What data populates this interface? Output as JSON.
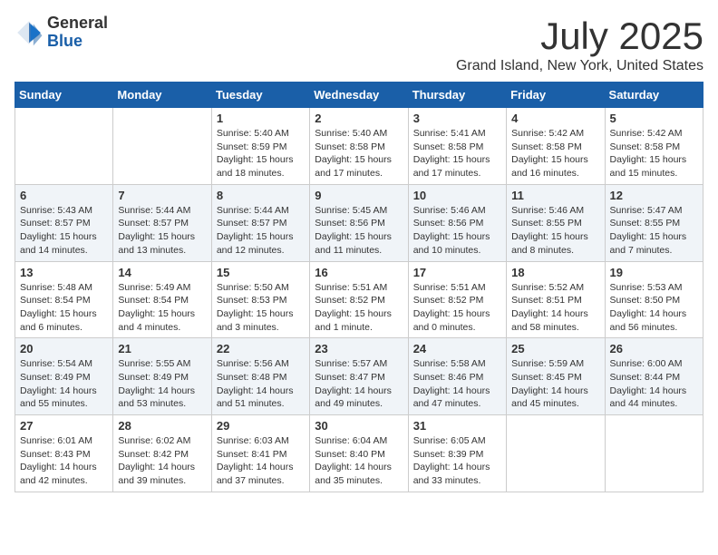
{
  "header": {
    "logo_general": "General",
    "logo_blue": "Blue",
    "month_title": "July 2025",
    "location": "Grand Island, New York, United States"
  },
  "weekdays": [
    "Sunday",
    "Monday",
    "Tuesday",
    "Wednesday",
    "Thursday",
    "Friday",
    "Saturday"
  ],
  "weeks": [
    [
      {
        "day": "",
        "sunrise": "",
        "sunset": "",
        "daylight": ""
      },
      {
        "day": "",
        "sunrise": "",
        "sunset": "",
        "daylight": ""
      },
      {
        "day": "1",
        "sunrise": "Sunrise: 5:40 AM",
        "sunset": "Sunset: 8:59 PM",
        "daylight": "Daylight: 15 hours and 18 minutes."
      },
      {
        "day": "2",
        "sunrise": "Sunrise: 5:40 AM",
        "sunset": "Sunset: 8:58 PM",
        "daylight": "Daylight: 15 hours and 17 minutes."
      },
      {
        "day": "3",
        "sunrise": "Sunrise: 5:41 AM",
        "sunset": "Sunset: 8:58 PM",
        "daylight": "Daylight: 15 hours and 17 minutes."
      },
      {
        "day": "4",
        "sunrise": "Sunrise: 5:42 AM",
        "sunset": "Sunset: 8:58 PM",
        "daylight": "Daylight: 15 hours and 16 minutes."
      },
      {
        "day": "5",
        "sunrise": "Sunrise: 5:42 AM",
        "sunset": "Sunset: 8:58 PM",
        "daylight": "Daylight: 15 hours and 15 minutes."
      }
    ],
    [
      {
        "day": "6",
        "sunrise": "Sunrise: 5:43 AM",
        "sunset": "Sunset: 8:57 PM",
        "daylight": "Daylight: 15 hours and 14 minutes."
      },
      {
        "day": "7",
        "sunrise": "Sunrise: 5:44 AM",
        "sunset": "Sunset: 8:57 PM",
        "daylight": "Daylight: 15 hours and 13 minutes."
      },
      {
        "day": "8",
        "sunrise": "Sunrise: 5:44 AM",
        "sunset": "Sunset: 8:57 PM",
        "daylight": "Daylight: 15 hours and 12 minutes."
      },
      {
        "day": "9",
        "sunrise": "Sunrise: 5:45 AM",
        "sunset": "Sunset: 8:56 PM",
        "daylight": "Daylight: 15 hours and 11 minutes."
      },
      {
        "day": "10",
        "sunrise": "Sunrise: 5:46 AM",
        "sunset": "Sunset: 8:56 PM",
        "daylight": "Daylight: 15 hours and 10 minutes."
      },
      {
        "day": "11",
        "sunrise": "Sunrise: 5:46 AM",
        "sunset": "Sunset: 8:55 PM",
        "daylight": "Daylight: 15 hours and 8 minutes."
      },
      {
        "day": "12",
        "sunrise": "Sunrise: 5:47 AM",
        "sunset": "Sunset: 8:55 PM",
        "daylight": "Daylight: 15 hours and 7 minutes."
      }
    ],
    [
      {
        "day": "13",
        "sunrise": "Sunrise: 5:48 AM",
        "sunset": "Sunset: 8:54 PM",
        "daylight": "Daylight: 15 hours and 6 minutes."
      },
      {
        "day": "14",
        "sunrise": "Sunrise: 5:49 AM",
        "sunset": "Sunset: 8:54 PM",
        "daylight": "Daylight: 15 hours and 4 minutes."
      },
      {
        "day": "15",
        "sunrise": "Sunrise: 5:50 AM",
        "sunset": "Sunset: 8:53 PM",
        "daylight": "Daylight: 15 hours and 3 minutes."
      },
      {
        "day": "16",
        "sunrise": "Sunrise: 5:51 AM",
        "sunset": "Sunset: 8:52 PM",
        "daylight": "Daylight: 15 hours and 1 minute."
      },
      {
        "day": "17",
        "sunrise": "Sunrise: 5:51 AM",
        "sunset": "Sunset: 8:52 PM",
        "daylight": "Daylight: 15 hours and 0 minutes."
      },
      {
        "day": "18",
        "sunrise": "Sunrise: 5:52 AM",
        "sunset": "Sunset: 8:51 PM",
        "daylight": "Daylight: 14 hours and 58 minutes."
      },
      {
        "day": "19",
        "sunrise": "Sunrise: 5:53 AM",
        "sunset": "Sunset: 8:50 PM",
        "daylight": "Daylight: 14 hours and 56 minutes."
      }
    ],
    [
      {
        "day": "20",
        "sunrise": "Sunrise: 5:54 AM",
        "sunset": "Sunset: 8:49 PM",
        "daylight": "Daylight: 14 hours and 55 minutes."
      },
      {
        "day": "21",
        "sunrise": "Sunrise: 5:55 AM",
        "sunset": "Sunset: 8:49 PM",
        "daylight": "Daylight: 14 hours and 53 minutes."
      },
      {
        "day": "22",
        "sunrise": "Sunrise: 5:56 AM",
        "sunset": "Sunset: 8:48 PM",
        "daylight": "Daylight: 14 hours and 51 minutes."
      },
      {
        "day": "23",
        "sunrise": "Sunrise: 5:57 AM",
        "sunset": "Sunset: 8:47 PM",
        "daylight": "Daylight: 14 hours and 49 minutes."
      },
      {
        "day": "24",
        "sunrise": "Sunrise: 5:58 AM",
        "sunset": "Sunset: 8:46 PM",
        "daylight": "Daylight: 14 hours and 47 minutes."
      },
      {
        "day": "25",
        "sunrise": "Sunrise: 5:59 AM",
        "sunset": "Sunset: 8:45 PM",
        "daylight": "Daylight: 14 hours and 45 minutes."
      },
      {
        "day": "26",
        "sunrise": "Sunrise: 6:00 AM",
        "sunset": "Sunset: 8:44 PM",
        "daylight": "Daylight: 14 hours and 44 minutes."
      }
    ],
    [
      {
        "day": "27",
        "sunrise": "Sunrise: 6:01 AM",
        "sunset": "Sunset: 8:43 PM",
        "daylight": "Daylight: 14 hours and 42 minutes."
      },
      {
        "day": "28",
        "sunrise": "Sunrise: 6:02 AM",
        "sunset": "Sunset: 8:42 PM",
        "daylight": "Daylight: 14 hours and 39 minutes."
      },
      {
        "day": "29",
        "sunrise": "Sunrise: 6:03 AM",
        "sunset": "Sunset: 8:41 PM",
        "daylight": "Daylight: 14 hours and 37 minutes."
      },
      {
        "day": "30",
        "sunrise": "Sunrise: 6:04 AM",
        "sunset": "Sunset: 8:40 PM",
        "daylight": "Daylight: 14 hours and 35 minutes."
      },
      {
        "day": "31",
        "sunrise": "Sunrise: 6:05 AM",
        "sunset": "Sunset: 8:39 PM",
        "daylight": "Daylight: 14 hours and 33 minutes."
      },
      {
        "day": "",
        "sunrise": "",
        "sunset": "",
        "daylight": ""
      },
      {
        "day": "",
        "sunrise": "",
        "sunset": "",
        "daylight": ""
      }
    ]
  ]
}
